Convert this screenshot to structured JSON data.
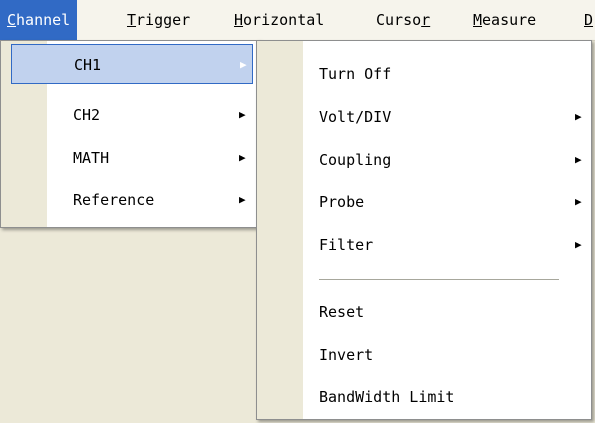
{
  "menubar": {
    "items": [
      {
        "label_rest": "hannel",
        "accel": "C",
        "accel_pos": "start",
        "active": true
      },
      {
        "label_rest": "rigger",
        "accel": "T",
        "accel_pos": "start"
      },
      {
        "label_rest": "orizontal",
        "accel": "H",
        "accel_pos": "start"
      },
      {
        "label_pre": "Curso",
        "accel": "r",
        "accel_pos": "end"
      },
      {
        "label_rest": "easure",
        "accel": "M",
        "accel_pos": "start"
      },
      {
        "label_rest": "",
        "accel": "D",
        "accel_pos": "start"
      }
    ]
  },
  "channel_menu": {
    "items": [
      {
        "label": "CH1",
        "has_submenu": true,
        "highlighted": true
      },
      {
        "label": "CH2",
        "has_submenu": true
      },
      {
        "label": "MATH",
        "has_submenu": true
      },
      {
        "label": "Reference",
        "has_submenu": true
      }
    ]
  },
  "ch1_submenu": {
    "items": [
      {
        "label": "Turn Off",
        "has_submenu": false
      },
      {
        "label": "Volt/DIV",
        "has_submenu": true
      },
      {
        "label": "Coupling",
        "has_submenu": true
      },
      {
        "label": "Probe",
        "has_submenu": true
      },
      {
        "label": "Filter",
        "has_submenu": true
      },
      {
        "label": "Reset",
        "has_submenu": false
      },
      {
        "label": "Invert",
        "has_submenu": false
      },
      {
        "label": "BandWidth Limit",
        "has_submenu": false
      }
    ]
  },
  "icons": {
    "submenu_arrow": "triangle-right-icon"
  },
  "colors": {
    "menubar_active_bg": "#316ac5",
    "menu_highlight_bg": "#c1d2ee",
    "menu_gutter": "#ece9d8"
  }
}
